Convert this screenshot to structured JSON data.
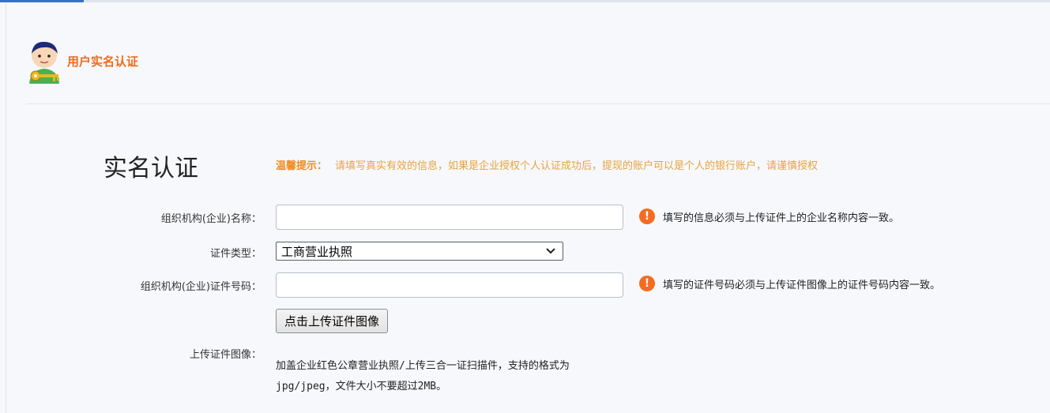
{
  "header": {
    "title": "用户实名认证"
  },
  "form": {
    "title": "实名认证",
    "tip": {
      "label": "温馨提示：",
      "text": "请填写真实有效的信息，如果是企业授权个人认证成功后，提现的账户可以是个人的银行账户，请谨慎授权"
    },
    "fields": {
      "org_name": {
        "label": "组织机构(企业)名称：",
        "value": "",
        "hint": "填写的信息必须与上传证件上的企业名称内容一致。"
      },
      "cert_type": {
        "label": "证件类型：",
        "selected": "工商营业执照"
      },
      "cert_number": {
        "label": "组织机构(企业)证件号码：",
        "value": "",
        "hint": "填写的证件号码必须与上传证件图像上的证件号码内容一致。"
      },
      "upload": {
        "label": "上传证件图像：",
        "button": "点击上传证件图像",
        "desc_line1": "加盖企业红色公章营业执照/上传三合一证扫描件，支持的格式为",
        "desc_line2": "jpg/jpeg，文件大小不要超过2MB。"
      }
    },
    "warn_icon_glyph": "!"
  },
  "colors": {
    "accent_orange": "#f26a1b",
    "tip": "#e8a33e",
    "warn": "#f36c21",
    "tab_active": "#3a6fc4"
  },
  "icons": [
    "user-key-avatar-icon",
    "warning-icon",
    "chevron-down-icon"
  ]
}
